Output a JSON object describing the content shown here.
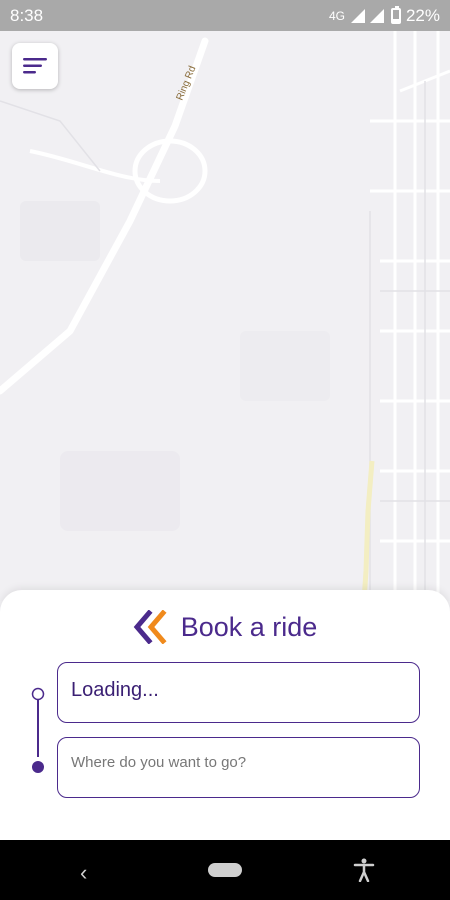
{
  "status_bar": {
    "time": "8:38",
    "network": "4G",
    "battery": "22%"
  },
  "map": {
    "road_label": "Ring Rd"
  },
  "booking": {
    "title": "Book a ride",
    "pickup_value": "Loading...",
    "destination_placeholder": "Where do you want to go?"
  },
  "colors": {
    "brand_purple": "#4b2a8c",
    "brand_orange": "#f08a1c"
  },
  "icons": {
    "menu": "menu-icon",
    "brand": "chevrons-logo-icon",
    "back": "back-icon",
    "home": "home-pill-icon",
    "accessibility": "accessibility-icon"
  }
}
